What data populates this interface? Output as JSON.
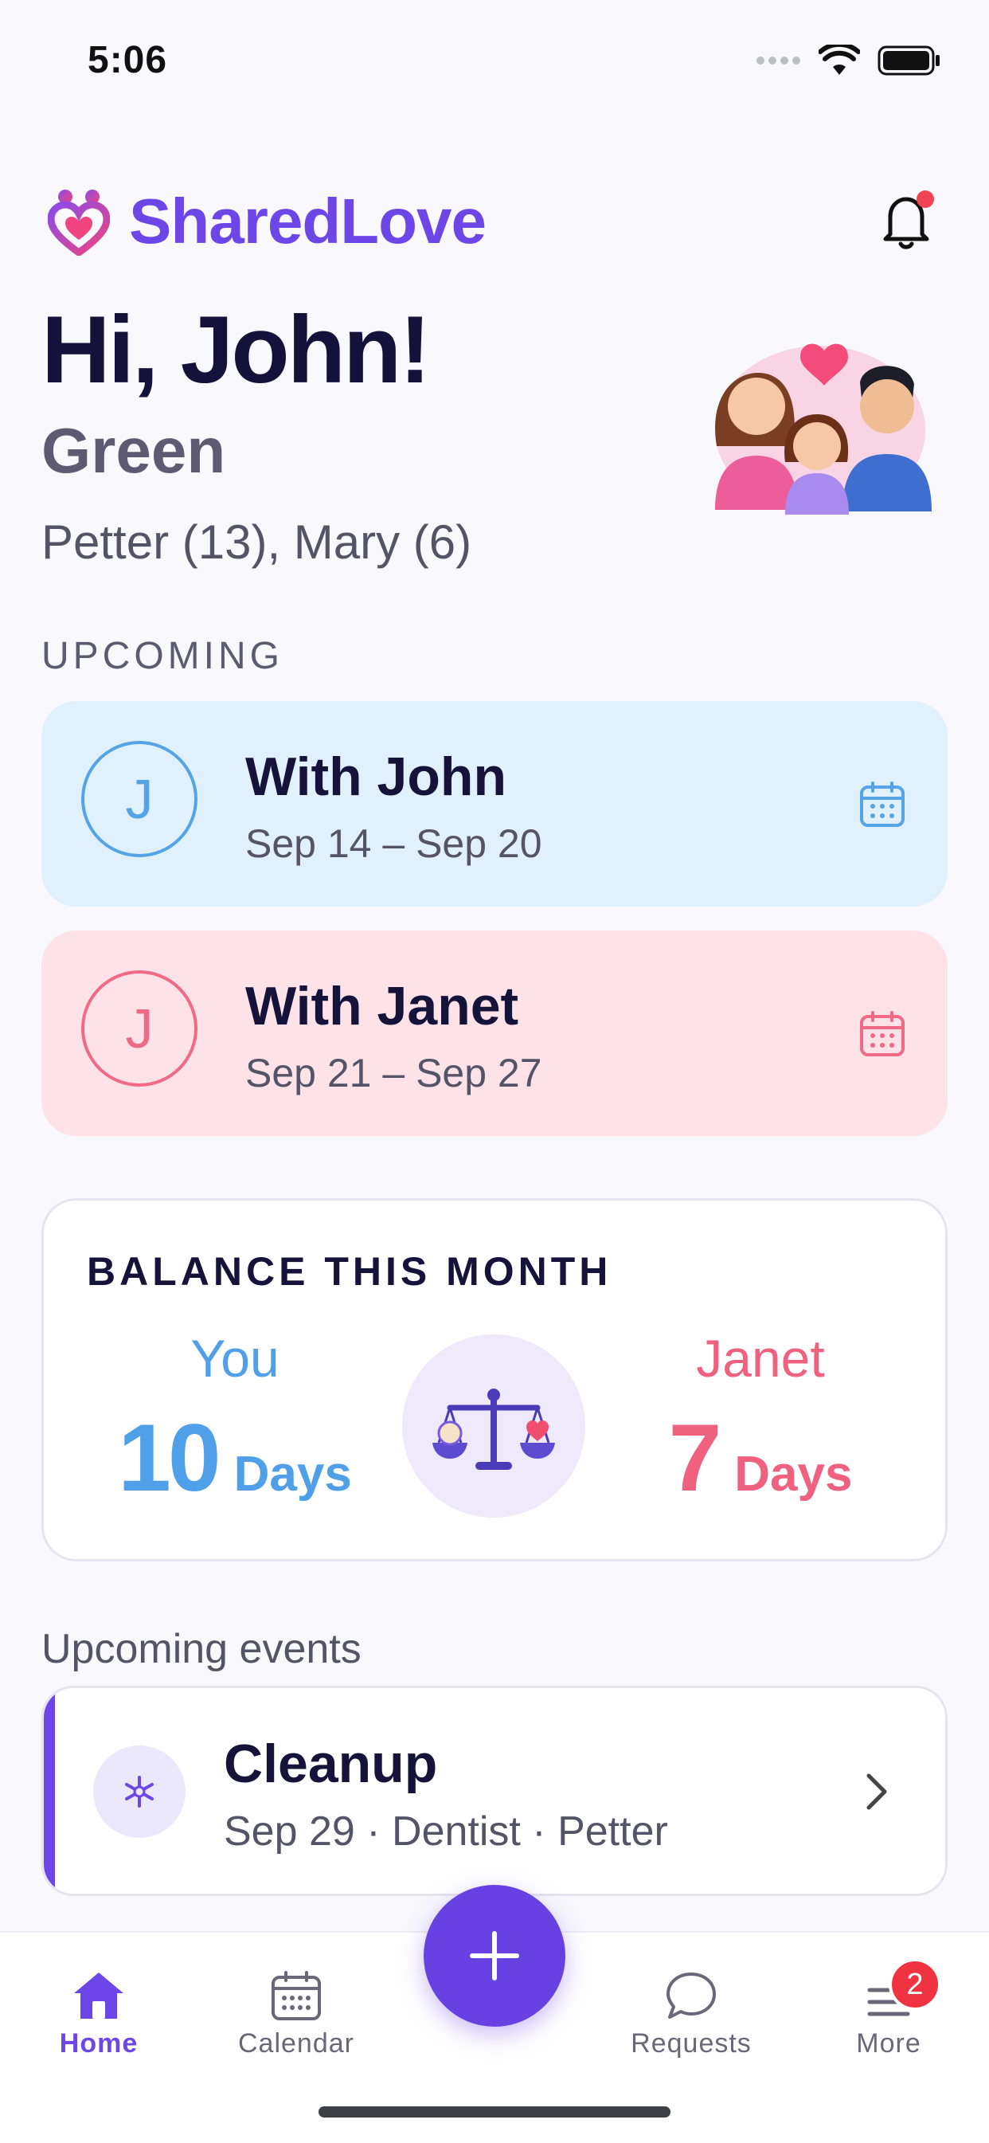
{
  "status_bar": {
    "time": "5:06"
  },
  "header": {
    "brand": "SharedLove",
    "notifications_dot": true
  },
  "greeting": {
    "title": "Hi, John!",
    "last_name": "Green",
    "children": "Petter (13), Mary (6)"
  },
  "upcoming": {
    "label": "UPCOMING",
    "items": [
      {
        "initial": "J",
        "title": "With John",
        "dates": "Sep 14 – Sep 20",
        "color": "#55A4E6"
      },
      {
        "initial": "J",
        "title": "With Janet",
        "dates": "Sep 21 – Sep 27",
        "color": "#F06A86"
      }
    ]
  },
  "balance": {
    "title": "BALANCE THIS MONTH",
    "you": {
      "name": "You",
      "days": "10",
      "unit": "Days"
    },
    "janet": {
      "name": "Janet",
      "days": "7",
      "unit": "Days"
    }
  },
  "events": {
    "label": "Upcoming events",
    "items": [
      {
        "title": "Cleanup",
        "subtitle": "Sep 29 · Dentist · Petter",
        "icon": "tooth-icon"
      }
    ]
  },
  "tabbar": {
    "home": "Home",
    "calendar": "Calendar",
    "requests": "Requests",
    "more": "More",
    "more_badge": "2"
  },
  "colors": {
    "accent": "#6C46E6",
    "john": "#4FA0E8",
    "janet": "#F0607F"
  }
}
